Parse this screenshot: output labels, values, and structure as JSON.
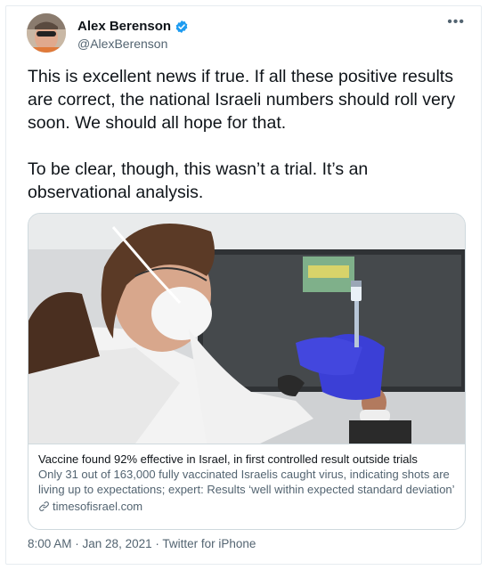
{
  "author": {
    "name": "Alex Berenson",
    "handle": "@AlexBerenson",
    "verified_icon": "verified-badge-icon"
  },
  "more_icon": "more-icon",
  "more_label": "•••",
  "tweet_text": "This is excellent news if true. If all these positive results are correct, the national Israeli numbers should roll very soon. We should all hope for that.\n\nTo be clear, though, this wasn’t a trial. It’s an observational analysis.",
  "card": {
    "title": "Vaccine found 92% effective in Israel, in first controlled result outside trials",
    "description": "Only 31 out of 163,000 fully vaccinated Israelis caught virus, indicating shots are living up to expectations; expert: Results ‘well within expected standard deviation’",
    "domain": "timesofisrael.com",
    "domain_icon": "link-icon"
  },
  "meta": {
    "time": "8:00 AM",
    "separator": " · ",
    "date": "Jan 28, 2021",
    "source": "Twitter for iPhone"
  },
  "colors": {
    "accent": "#1d9bf0",
    "secondary_text": "#536471",
    "border": "#cfd9de",
    "glove": "#3b3fd6"
  }
}
